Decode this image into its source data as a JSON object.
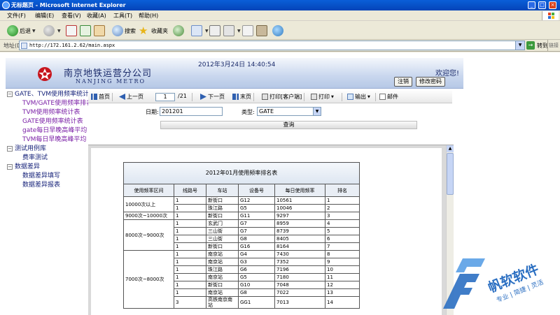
{
  "window": {
    "title": "无标题页 - Microsoft Internet Explorer",
    "buttons": [
      "_",
      "□",
      "×"
    ]
  },
  "menu": [
    "文件(F)",
    "编辑(E)",
    "查看(V)",
    "收藏(A)",
    "工具(T)",
    "帮助(H)"
  ],
  "toolbar": {
    "back": "后退",
    "search": "搜索",
    "favorites": "收藏夹"
  },
  "address": {
    "label": "地址(D)",
    "url": "http://172.161.2.62/main.aspx",
    "go": "转到",
    "links": "链接"
  },
  "header": {
    "company": "南京地铁运营分公司",
    "company_en": "NANJING METRO",
    "datetime": "2012年3月24日  14:40:54",
    "welcome": "欢迎您!",
    "logout": "注销",
    "change_password": "修改密码"
  },
  "tree": [
    {
      "level": 0,
      "toggle": "−",
      "label": "GATE、TVM使用频率统计"
    },
    {
      "level": 1,
      "label": "TVM/GATE使用频率排名"
    },
    {
      "level": 1,
      "label": "TVM使用频率统计表"
    },
    {
      "level": 1,
      "label": "GATE使用频率统计表"
    },
    {
      "level": 1,
      "label": "gate每日早晚高峰平均"
    },
    {
      "level": 1,
      "label": "TVM每日早晚高峰平均"
    },
    {
      "level": 0,
      "toggle": "−",
      "label": "测试用例库"
    },
    {
      "level": 2,
      "label": "费率测试"
    },
    {
      "level": 0,
      "toggle": "−",
      "label": "数据差异"
    },
    {
      "level": 2,
      "label": "数据差异填写"
    },
    {
      "level": 2,
      "label": "数据差异报表"
    }
  ],
  "report_toolbar": {
    "first": "首页",
    "prev": "上一页",
    "page": "1",
    "total": "/21",
    "next": "下一页",
    "last": "末页",
    "print_client": "打印[客户端]",
    "print": "打印",
    "export": "输出",
    "mail": "邮件"
  },
  "query": {
    "date_label": "日期:",
    "date_value": "201201",
    "type_label": "类型:",
    "type_value": "GATE",
    "button": "查询"
  },
  "report": {
    "title": "2012年01月使用频率排名表",
    "columns": [
      "使用频率区间",
      "线路号",
      "车站",
      "设备号",
      "每日使用频率",
      "排名"
    ],
    "groups": [
      {
        "range": "10000次以上",
        "rows": [
          [
            "1",
            "新街口",
            "G12",
            "10561",
            "1"
          ],
          [
            "1",
            "珠江路",
            "G5",
            "10046",
            "2"
          ]
        ]
      },
      {
        "range": "9000次~10000次",
        "rows": [
          [
            "1",
            "新街口",
            "G11",
            "9297",
            "3"
          ]
        ]
      },
      {
        "range": "8000次~9000次",
        "rows": [
          [
            "1",
            "玄武门",
            "G7",
            "8959",
            "4"
          ],
          [
            "1",
            "三山街",
            "G7",
            "8739",
            "5"
          ],
          [
            "1",
            "三山街",
            "G8",
            "8405",
            "6"
          ],
          [
            "1",
            "新街口",
            "G16",
            "8164",
            "7"
          ]
        ]
      },
      {
        "range": "7000次~8000次",
        "rows": [
          [
            "1",
            "南京站",
            "G4",
            "7430",
            "8"
          ],
          [
            "1",
            "南京站",
            "G3",
            "7352",
            "9"
          ],
          [
            "1",
            "珠江路",
            "G6",
            "7196",
            "10"
          ],
          [
            "1",
            "南京站",
            "G5",
            "7180",
            "11"
          ],
          [
            "1",
            "新街口",
            "G10",
            "7048",
            "12"
          ],
          [
            "1",
            "南京站",
            "G8",
            "7022",
            "13"
          ],
          [
            "3",
            "高铁南京南站",
            "GG1",
            "7013",
            "14"
          ]
        ]
      }
    ]
  },
  "watermark": {
    "brand": "帆软软件",
    "slogan": "专业 | 简捷 | 灵活"
  },
  "colors": {
    "title_bar": "#0a5fd8",
    "banner_text": "#1a2a6a",
    "tree_link": "#7a1fa6",
    "watermark": "#2b6fc2"
  }
}
